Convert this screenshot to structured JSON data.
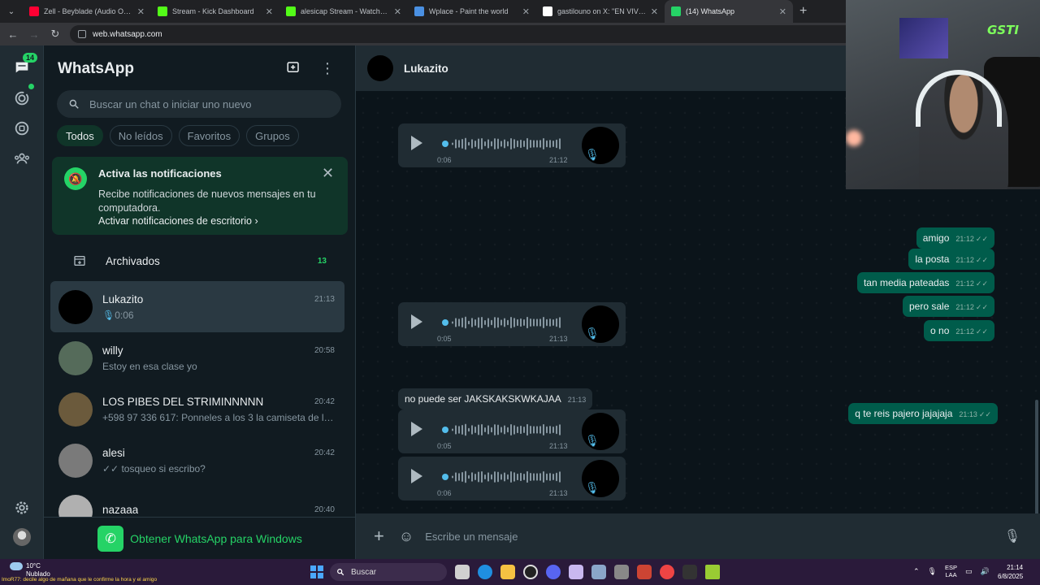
{
  "browser": {
    "tabs": [
      {
        "title": "Zell - Beyblade (Audio Oficial)",
        "color": "#ff0033",
        "active": false
      },
      {
        "title": "Stream - Kick Dashboard",
        "color": "#53fc18",
        "active": false
      },
      {
        "title": "alesicap Stream - Watch Live on Kick",
        "color": "#53fc18",
        "active": false
      },
      {
        "title": "Wplace - Paint the world",
        "color": "#4a90e2",
        "active": false
      },
      {
        "title": "gastilouno on X: \"EN VIVOOO !!!",
        "color": "#ffffff",
        "active": false
      },
      {
        "title": "(14) WhatsApp",
        "color": "#25d366",
        "active": true
      }
    ],
    "url": "web.whatsapp.com"
  },
  "rail": {
    "chats_badge": "14"
  },
  "sidebar": {
    "title": "WhatsApp",
    "search_placeholder": "Buscar un chat o iniciar uno nuevo",
    "filters": [
      "Todos",
      "No leídos",
      "Favoritos",
      "Grupos"
    ],
    "notification": {
      "title": "Activa las notificaciones",
      "text": "Recibe notificaciones de nuevos mensajes en tu computadora.",
      "link": "Activar notificaciones de escritorio"
    },
    "archived": {
      "label": "Archivados",
      "count": "13"
    },
    "chats": [
      {
        "name": "Lukazito",
        "time": "21:13",
        "preview": "0:06",
        "voice": true,
        "avatar": "#000000"
      },
      {
        "name": "willy",
        "time": "20:58",
        "preview": "Estoy en esa clase yo",
        "voice": false,
        "avatar": "#556b5a"
      },
      {
        "name": "LOS PIBES DEL STRIMINNNNN",
        "time": "20:42",
        "preview": "+598 97 336 617: Ponneles a los 3 la camiseta de la b...",
        "voice": false,
        "avatar": "#6b5a3c"
      },
      {
        "name": "alesi",
        "time": "20:42",
        "preview": "✓✓ tosqueo si escribo?",
        "voice": false,
        "avatar": "#7a7a7a"
      },
      {
        "name": "nazaaa",
        "time": "20:40",
        "preview": "",
        "voice": false,
        "avatar": "#b0b0b0"
      }
    ],
    "get_windows": "Obtener WhatsApp para Windows"
  },
  "conversation": {
    "name": "Lukazito",
    "messages_in": [
      {
        "kind": "voice",
        "duration": "0:06",
        "time": "21:12"
      },
      {
        "kind": "voice",
        "duration": "0:05",
        "time": "21:13"
      },
      {
        "kind": "text",
        "text": "no puede ser JAKSKAKSKWKAJAA",
        "time": "21:13"
      },
      {
        "kind": "voice",
        "duration": "0:05",
        "time": "21:13"
      },
      {
        "kind": "voice",
        "duration": "0:06",
        "time": "21:13"
      }
    ],
    "messages_out": [
      {
        "text": "amigo",
        "time": "21:12"
      },
      {
        "text": "la posta",
        "time": "21:12"
      },
      {
        "text": "tan media pateadas",
        "time": "21:12"
      },
      {
        "text": "pero sale",
        "time": "21:12"
      },
      {
        "text": "o no",
        "time": "21:12"
      },
      {
        "text": "q te reis pajero jajajaja",
        "time": "21:13"
      }
    ],
    "composer_placeholder": "Escribe un mensaje"
  },
  "overlay": {
    "logo": "GSTI"
  },
  "taskbar": {
    "temp": "10°C",
    "weather": "Nublado",
    "ticker": "ImoR77: decile algo de mañana que le confirme la hora y el amigo",
    "search": "Buscar",
    "lang_top": "ESP",
    "lang_bottom": "LAA",
    "time": "21:14",
    "date": "6/8/2025"
  }
}
